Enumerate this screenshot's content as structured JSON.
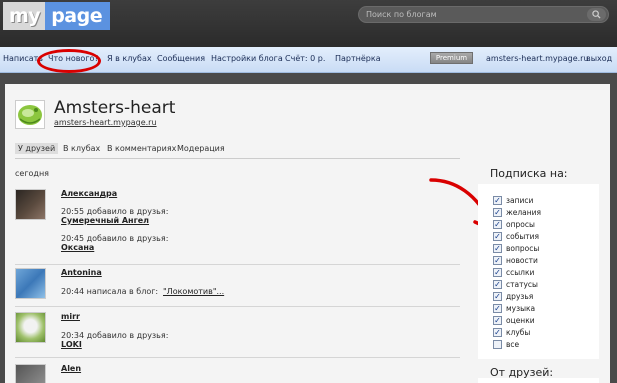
{
  "header": {
    "logo_my": "my",
    "logo_page": "page",
    "search_placeholder": "Поиск по блогам"
  },
  "nav": {
    "items": [
      "Написать",
      "Что нового?",
      "Я в клубах",
      "Сообщения",
      "Настройки блога",
      "Счёт: 0 р.",
      "Партнёрка"
    ],
    "premium": "Premium",
    "blog_url": "amsters-heart.mypage.ru",
    "logout": "выход"
  },
  "profile": {
    "name": "Amsters-heart",
    "url": "amsters-heart.mypage.ru"
  },
  "tabs": [
    "У друзей",
    "В клубах",
    "В комментариях",
    "Модерация"
  ],
  "feed": {
    "day_label": "сегодня",
    "items": [
      {
        "user": "Александра",
        "events": [
          {
            "time_text": "20:55 добавило в друзья:",
            "link": "Сумеречный Ангел"
          },
          {
            "time_text": "20:45 добавило в друзья:",
            "link": "Оксана"
          }
        ]
      },
      {
        "user": "Antonina",
        "events": [
          {
            "time_text": "20:44 написала в блог: ",
            "link": "\"Локомотив\"..."
          }
        ]
      },
      {
        "user": "mirr",
        "events": [
          {
            "time_text": "20:34 добавило в друзья:",
            "link": "LOKI"
          }
        ]
      },
      {
        "user": "Alen",
        "events": []
      }
    ]
  },
  "subscribe": {
    "title": "Подписка на:",
    "items": [
      {
        "label": "записи",
        "checked": true
      },
      {
        "label": "желания",
        "checked": true
      },
      {
        "label": "опросы",
        "checked": true
      },
      {
        "label": "события",
        "checked": true
      },
      {
        "label": "вопросы",
        "checked": true
      },
      {
        "label": "новости",
        "checked": true
      },
      {
        "label": "ссылки",
        "checked": true
      },
      {
        "label": "статусы",
        "checked": true
      },
      {
        "label": "друзья",
        "checked": true
      },
      {
        "label": "музыка",
        "checked": true
      },
      {
        "label": "оценки",
        "checked": true
      },
      {
        "label": "клубы",
        "checked": true
      },
      {
        "label": "все",
        "checked": false
      }
    ]
  },
  "from_friends": {
    "title": "От друзей:"
  },
  "colors": {
    "nav_bg": "#d4e4f8",
    "annotation_red": "#d90000",
    "logo_blue": "#5b92e0"
  }
}
